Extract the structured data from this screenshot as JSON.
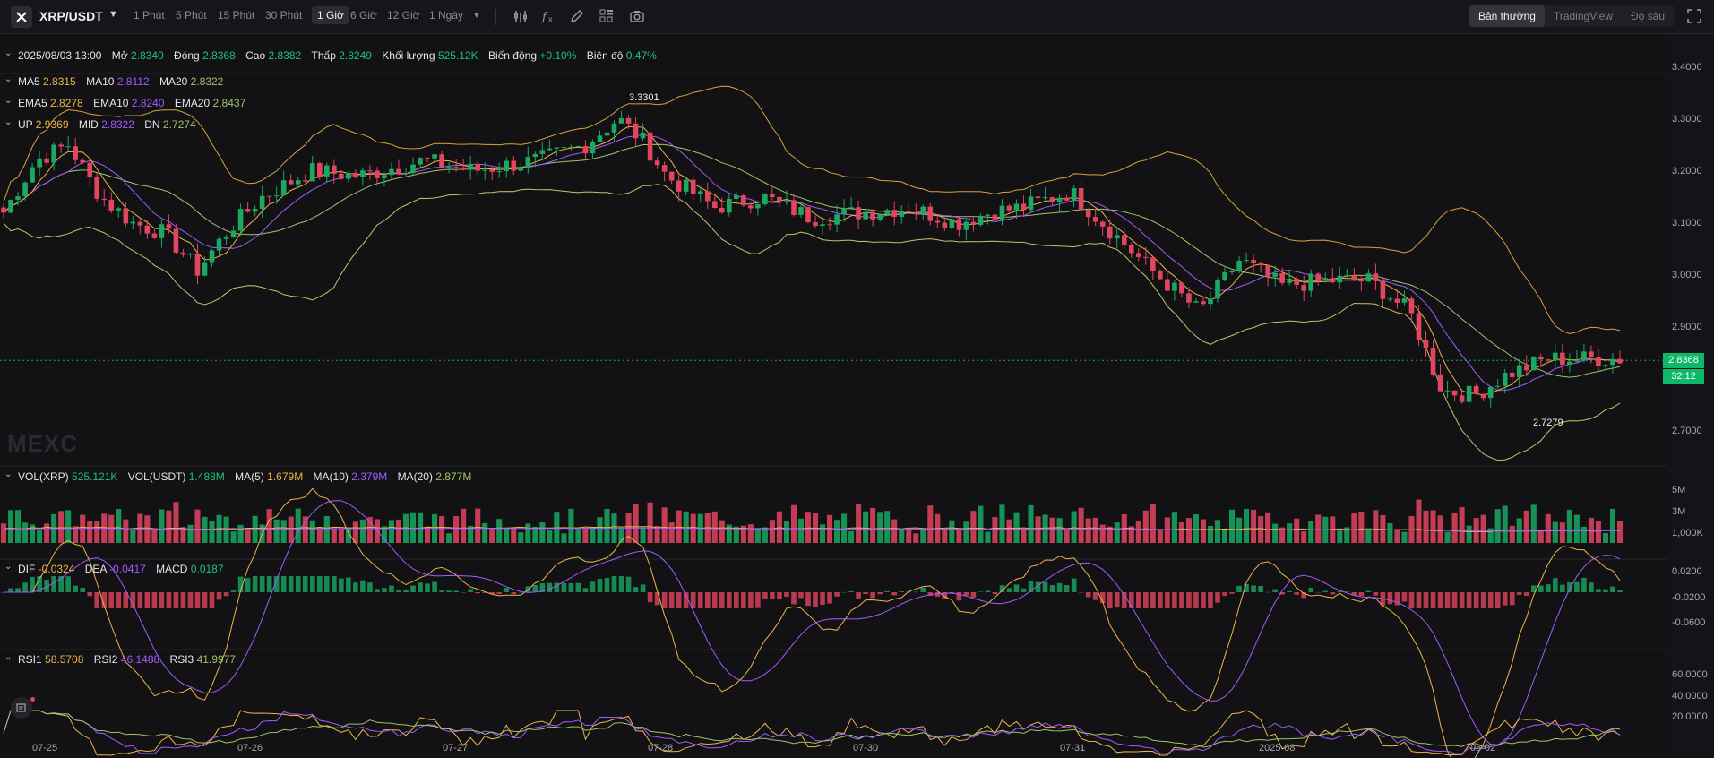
{
  "header": {
    "pair": "XRP/USDT",
    "timeframes": [
      "1 Phút",
      "5 Phút",
      "15 Phút",
      "30 Phút",
      "1 Giờ",
      "6 Giờ",
      "12 Giờ",
      "1 Ngày"
    ],
    "active_timeframe": "1 Giờ",
    "views": [
      "Bản thường",
      "TradingView",
      "Độ sâu"
    ],
    "active_view": "Bản thường"
  },
  "ohlc": {
    "date": "2025/08/03 13:00",
    "open_label": "Mở",
    "open": "2.8340",
    "close_label": "Đóng",
    "close": "2.8368",
    "high_label": "Cao",
    "high": "2.8382",
    "low_label": "Thấp",
    "low": "2.8249",
    "volume_label": "Khối lượng",
    "volume": "525.12K",
    "change_label": "Biến động",
    "change": "+0.10%",
    "amplitude_label": "Biên độ",
    "amplitude": "0.47%"
  },
  "ma": {
    "ma5_label": "MA5",
    "ma5": "2.8315",
    "ma10_label": "MA10",
    "ma10": "2.8112",
    "ma20_label": "MA20",
    "ma20": "2.8322"
  },
  "ema": {
    "ema5_label": "EMA5",
    "ema5": "2.8278",
    "ema10_label": "EMA10",
    "ema10": "2.8240",
    "ema20_label": "EMA20",
    "ema20": "2.8437"
  },
  "boll": {
    "up_label": "UP",
    "up": "2.9369",
    "mid_label": "MID",
    "mid": "2.8322",
    "dn_label": "DN",
    "dn": "2.7274"
  },
  "price_axis": [
    "3.4000",
    "3.3000",
    "3.2000",
    "3.1000",
    "3.0000",
    "2.9000",
    "2.7000"
  ],
  "current_price": "2.8368",
  "countdown": "32:12",
  "high_marker": "3.3301",
  "low_marker": "2.7279",
  "watermark": "MEXC",
  "vol": {
    "vol_xrp_label": "VOL(XRP)",
    "vol_xrp": "525.121K",
    "vol_usdt_label": "VOL(USDT)",
    "vol_usdt": "1.488M",
    "ma5_label": "MA(5)",
    "ma5": "1.679M",
    "ma10_label": "MA(10)",
    "ma10": "2.379M",
    "ma20_label": "MA(20)",
    "ma20": "2.877M",
    "axis": [
      "5M",
      "3M",
      "1,000K"
    ]
  },
  "macd": {
    "dif_label": "DIF",
    "dif": "-0.0324",
    "dea_label": "DEA",
    "dea": "-0.0417",
    "macd_label": "MACD",
    "macd": "0.0187",
    "axis": [
      "0.0200",
      "-0.0200",
      "-0.0600"
    ]
  },
  "rsi": {
    "rsi1_label": "RSI1",
    "rsi1": "58.5708",
    "rsi2_label": "RSI2",
    "rsi2": "46.1488",
    "rsi3_label": "RSI3",
    "rsi3": "41.9977",
    "axis": [
      "60.0000",
      "40.0000",
      "20.0000"
    ]
  },
  "date_axis": [
    "07-25",
    "07-26",
    "07-27",
    "07-28",
    "07-30",
    "07-31",
    "2025-08",
    "08-02"
  ],
  "colors": {
    "up": "#1aa863",
    "down": "#e2455e",
    "ma5": "#f0b44a",
    "ma10": "#a45bff",
    "ma20": "#9fc46a",
    "boll": "#d9a23b",
    "price_tag": "#0fb768"
  },
  "chart_data": {
    "type": "candlestick",
    "ylim": [
      2.69,
      3.41
    ],
    "anchors": [
      [
        0,
        3.12
      ],
      [
        0.02,
        3.22
      ],
      [
        0.04,
        3.25
      ],
      [
        0.06,
        3.15
      ],
      [
        0.08,
        3.1
      ],
      [
        0.1,
        3.08
      ],
      [
        0.12,
        3.01
      ],
      [
        0.14,
        3.09
      ],
      [
        0.16,
        3.15
      ],
      [
        0.19,
        3.2
      ],
      [
        0.22,
        3.19
      ],
      [
        0.26,
        3.22
      ],
      [
        0.29,
        3.2
      ],
      [
        0.33,
        3.22
      ],
      [
        0.36,
        3.25
      ],
      [
        0.38,
        3.3
      ],
      [
        0.395,
        3.26
      ],
      [
        0.41,
        3.19
      ],
      [
        0.44,
        3.13
      ],
      [
        0.47,
        3.15
      ],
      [
        0.5,
        3.11
      ],
      [
        0.53,
        3.12
      ],
      [
        0.56,
        3.13
      ],
      [
        0.59,
        3.1
      ],
      [
        0.61,
        3.12
      ],
      [
        0.63,
        3.13
      ],
      [
        0.66,
        3.16
      ],
      [
        0.68,
        3.1
      ],
      [
        0.71,
        3.01
      ],
      [
        0.74,
        2.93
      ],
      [
        0.765,
        3.03
      ],
      [
        0.79,
        2.98
      ],
      [
        0.82,
        2.99
      ],
      [
        0.845,
        2.99
      ],
      [
        0.87,
        2.93
      ],
      [
        0.89,
        2.78
      ],
      [
        0.91,
        2.77
      ],
      [
        0.93,
        2.81
      ],
      [
        0.955,
        2.84
      ],
      [
        0.97,
        2.84
      ]
    ]
  }
}
